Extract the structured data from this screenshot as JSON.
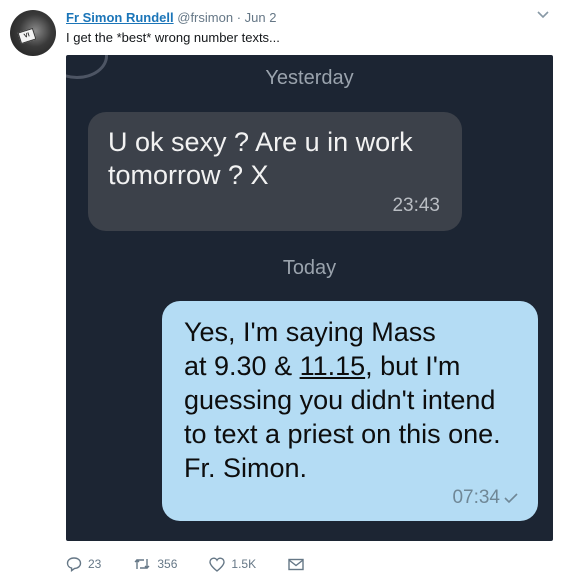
{
  "tweet": {
    "author_name": "Fr Simon Rundell",
    "handle": "@frsimon",
    "date": "· Jun 2",
    "text": "I get the *best* wrong number texts...",
    "avatar_collar_text": "VI"
  },
  "screenshot": {
    "day_label_1": "Yesterday",
    "received": {
      "text": "U ok sexy ? Are u in work tomorrow ? X",
      "time": "23:43"
    },
    "day_label_2": "Today",
    "sent": {
      "line1": "Yes, I'm saying Mass",
      "line2_a": "at 9.30 & ",
      "line2_link": "11.15",
      "line2_b": ", but I'm",
      "line3": "guessing you didn't intend",
      "line4": "to text a priest on this one.",
      "line5": "Fr. Simon.",
      "time": "07:34"
    }
  },
  "actions": {
    "replies": "23",
    "retweets": "356",
    "likes": "1.5K"
  },
  "icons": {
    "menu": "chevron-down-icon",
    "reply": "reply-icon",
    "retweet": "retweet-icon",
    "like": "heart-icon",
    "message": "envelope-icon",
    "read_receipt": "check-icon"
  },
  "colors": {
    "link": "#1b75b8",
    "photo_bg": "#1c2533",
    "received_bubble": "#3c414a",
    "sent_bubble": "#b4dcf4",
    "meta_gray": "#657786"
  }
}
